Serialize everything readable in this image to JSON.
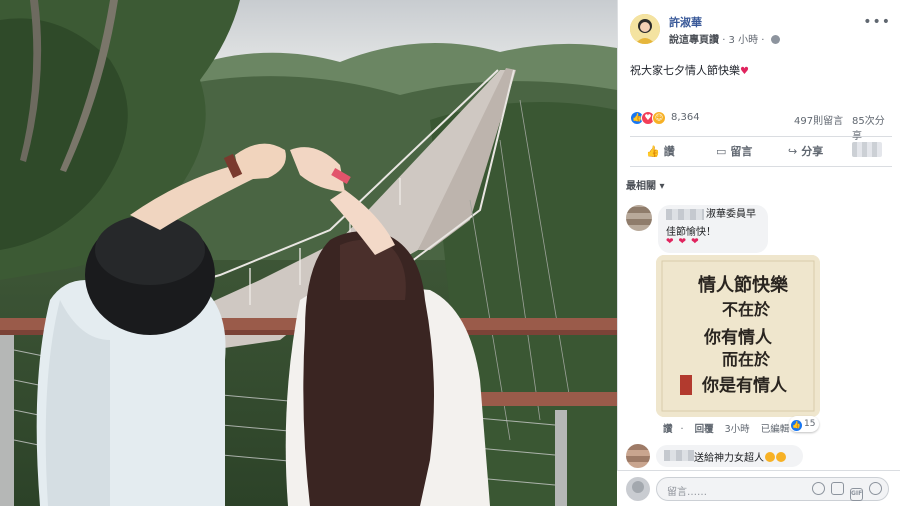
{
  "post": {
    "author": "許淑華",
    "sponsor_note": "說這專頁讚",
    "time": "3 小時",
    "text": "祝大家七夕情人節快樂",
    "more_menu": "•••"
  },
  "stats": {
    "reaction_total": "8,364",
    "reaction_types": [
      "like",
      "love",
      "haha"
    ],
    "comments": "497則留言",
    "shares": "85次分享"
  },
  "actions": {
    "like": "讚",
    "comment": "留言",
    "share": "分享"
  },
  "sort": {
    "label": "最相關",
    "arrow": "▾"
  },
  "comments": [
    {
      "text_line1": "淑華委員早",
      "text_line2": "佳節愉快！",
      "hearts": "❤❤❤",
      "sticker_lines": [
        "情人節快樂",
        "不在於",
        "你有情人",
        "而在於",
        "你是有情人"
      ],
      "like_label": "讚",
      "reply_label": "回覆",
      "time": "3小時",
      "edited": "已編輯",
      "like_count": "15"
    },
    {
      "text": "送給神力女超人"
    }
  ],
  "compose": {
    "placeholder": "留言……"
  },
  "colors": {
    "author_blue": "#385898",
    "like_blue": "#1877f2",
    "love_red": "#f33e58",
    "haha_yellow": "#f7b125"
  }
}
